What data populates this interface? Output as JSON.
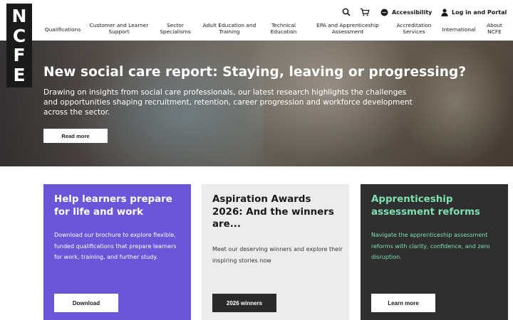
{
  "brand": {
    "logo_letters": [
      "N",
      "C",
      "F",
      "E"
    ]
  },
  "utility": {
    "search_icon": "search-icon",
    "cart_icon": "cart-icon",
    "accessibility_label": "Accessibility",
    "login_label": "Log in and Portal"
  },
  "nav": {
    "items": [
      {
        "label": "Qualifications"
      },
      {
        "label": "Customer and Learner\nSupport"
      },
      {
        "label": "Sector\nSpecialisms"
      },
      {
        "label": "Adult Education and\nTraining"
      },
      {
        "label": "Technical\nEducation"
      },
      {
        "label": "EPA and Apprenticeship\nAssessment"
      },
      {
        "label": "Accreditation\nServices"
      },
      {
        "label": "International"
      },
      {
        "label": "About\nNCFE"
      }
    ]
  },
  "hero": {
    "title": "New social care report: Staying, leaving or progressing?",
    "description": "Drawing on insights from social care professionals, our latest research highlights the challenges and opportunities shaping recruitment, retention, career progression and workforce development across the sector.",
    "button_label": "Read more"
  },
  "cards": [
    {
      "title": "Help learners prepare for life and work",
      "body": "Download our brochure to explore flexible, funded qualifications that prepare learners for work, training, and further study.",
      "button_label": "Download",
      "color": "#6b55d9"
    },
    {
      "title": "Aspiration Awards 2026: And the winners are...",
      "body": "Meet our deserving winners and explore their inspiring stories now",
      "button_label": "2026 winners",
      "color": "#ececec"
    },
    {
      "title": "Apprenticeship assessment reforms",
      "body": "Navigate the apprenticeship assessment reforms with clarity, confidence, and zero disruption.",
      "button_label": "Learn more",
      "color": "#2f2f2f",
      "accent": "#7ee0b0"
    }
  ]
}
